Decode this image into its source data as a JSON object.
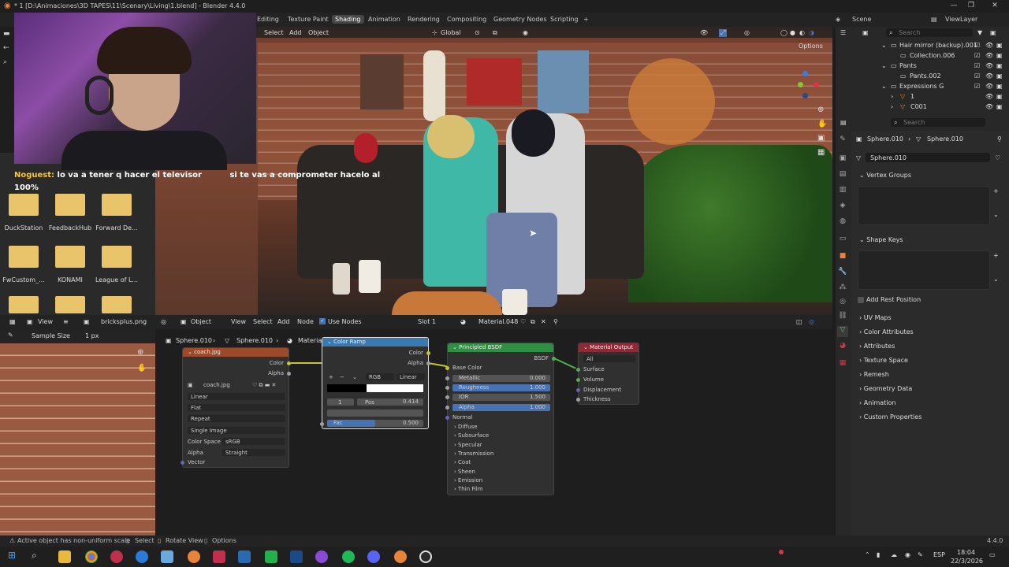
{
  "window": {
    "title": "* 1 [D:\\Animaciones\\3D TAPES\\11\\Scenary\\Living\\1.blend] - Blender 4.4.0"
  },
  "workspaces": [
    "Editing",
    "Texture Paint",
    "Shading",
    "Animation",
    "Rendering",
    "Compositing",
    "Geometry Nodes",
    "Scripting"
  ],
  "workspace_add": "+",
  "scene": {
    "label": "Scene",
    "view_layer": "ViewLayer"
  },
  "viewport_header": {
    "menus": [
      "Select",
      "Add",
      "Object"
    ],
    "orientation": "Global",
    "options": "Options"
  },
  "chat": {
    "user": "Noguest:",
    "message": "lo va a tener q hacer el televisor",
    "message2": "si te vas a comprometer hacelo al",
    "message3": "100%"
  },
  "desktop_folders": [
    {
      "label": "DuckStation"
    },
    {
      "label": "FeedbackHub"
    },
    {
      "label": "Forward De..."
    },
    {
      "label": "FwCustom_..."
    },
    {
      "label": "KONAMI"
    },
    {
      "label": "League of L..."
    }
  ],
  "node_editor_header": {
    "view": "View",
    "image_name": "bricksplus.png",
    "mode": "Object",
    "menus": [
      "View",
      "Select",
      "Add",
      "Node"
    ],
    "use_nodes": "Use Nodes",
    "slot": "Slot 1",
    "material": "Material.048"
  },
  "image_panel": {
    "sample_label": "Sample Size",
    "sample_value": "1 px"
  },
  "breadcrumb": {
    "obj": "Sphere.010",
    "mesh": "Sphere.010",
    "mat": "Material.048"
  },
  "nodes": {
    "image": {
      "title": "coach.jpg",
      "out_color": "Color",
      "out_alpha": "Alpha",
      "file": "coach.jpg",
      "interp": "Linear",
      "projection": "Flat",
      "extension": "Repeat",
      "source": "Single Image",
      "colorspace_label": "Color Space",
      "colorspace": "sRGB",
      "alpha_label": "Alpha",
      "alpha": "Straight",
      "vector": "Vector"
    },
    "ramp": {
      "title": "Color Ramp",
      "out_color": "Color",
      "out_alpha": "Alpha",
      "mode": "RGB",
      "interp": "Linear",
      "index": "1",
      "pos_label": "Pos",
      "pos": "0.414",
      "fac_label": "Fac",
      "fac": "0.500"
    },
    "bsdf": {
      "title": "Principled BSDF",
      "out": "BSDF",
      "base_color": "Base Color",
      "metallic_label": "Metallic",
      "metallic": "0.000",
      "roughness_label": "Roughness",
      "roughness": "1.000",
      "ior_label": "IOR",
      "ior": "1.500",
      "alpha_label": "Alpha",
      "alpha": "1.000",
      "normal": "Normal",
      "panels": [
        "Diffuse",
        "Subsurface",
        "Specular",
        "Transmission",
        "Coat",
        "Sheen",
        "Emission",
        "Thin Film"
      ]
    },
    "output": {
      "title": "Material Output",
      "target": "All",
      "surface": "Surface",
      "volume": "Volume",
      "displacement": "Displacement",
      "thickness": "Thickness"
    }
  },
  "outliner": {
    "search_placeholder": "Search",
    "items": [
      "Hair mirror (backup).001",
      "Collection.006",
      "Pants",
      "Pants.002",
      "Expressions G",
      "1",
      "C001"
    ]
  },
  "properties": {
    "search_placeholder": "Search",
    "crumb_obj": "Sphere.010",
    "crumb_mesh": "Sphere.010",
    "mesh_name": "Sphere.010",
    "vertex_groups": "Vertex Groups",
    "shape_keys": "Shape Keys",
    "add_rest_position": "Add Rest Position",
    "sections": [
      "UV Maps",
      "Color Attributes",
      "Attributes",
      "Texture Space",
      "Remesh",
      "Geometry Data",
      "Animation",
      "Custom Properties"
    ]
  },
  "statusbar": {
    "msg": "Active object has non-uniform scale",
    "select": "Select",
    "rotate": "Rotate View",
    "options": "Options",
    "version": "4.4.0"
  },
  "taskbar": {
    "lang": "ESP",
    "time": "18:04",
    "date": "22/3/2026"
  },
  "colors": {
    "accent": "#4772b3",
    "image_node": "#9c4a2a",
    "converter_node": "#3a7ab0",
    "shader_node": "#2f8f43",
    "output_node": "#8e2a36"
  }
}
